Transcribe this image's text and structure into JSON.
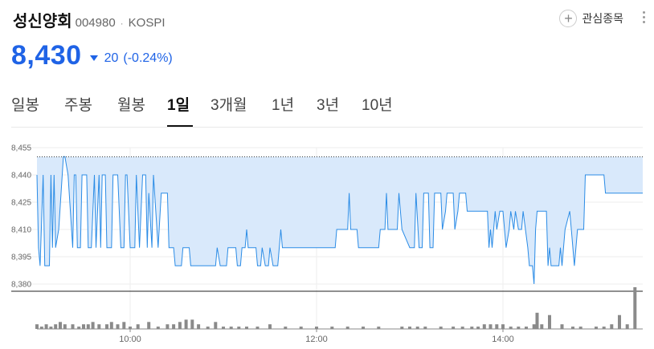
{
  "stock": {
    "name": "성신양회",
    "code": "004980",
    "market": "KOSPI",
    "price": "8,430",
    "change": "20",
    "change_pct": "(-0.24%)",
    "direction": "down",
    "accent_color": "#1f63e6"
  },
  "watchlist": {
    "label": "관심종목",
    "icon": "plus-circle-icon"
  },
  "more_menu": {
    "icon": "kebab-menu-icon"
  },
  "tabs": [
    {
      "label": "일봉",
      "active": false
    },
    {
      "label": "주봉",
      "active": false
    },
    {
      "label": "월봉",
      "active": false
    },
    {
      "label": "1일",
      "active": true
    },
    {
      "label": "3개월",
      "active": false
    },
    {
      "label": "1년",
      "active": false
    },
    {
      "label": "3년",
      "active": false
    },
    {
      "label": "10년",
      "active": false
    }
  ],
  "chart_data": {
    "type": "area",
    "y_ticks": [
      "8,455",
      "8,440",
      "8,425",
      "8,410",
      "8,395",
      "8,380"
    ],
    "ylim": [
      8380,
      8455
    ],
    "previous_close": 8450,
    "x_ticks": [
      "10:00",
      "12:00",
      "14:00"
    ],
    "time_range": [
      "09:00",
      "15:30"
    ],
    "line_color": "#2b8ce6",
    "fill_color": "#d9e9fb",
    "volume_color": "#8a8a8a",
    "price_points": [
      [
        "09:00",
        8440
      ],
      [
        "09:01",
        8400
      ],
      [
        "09:02",
        8390
      ],
      [
        "09:04",
        8440
      ],
      [
        "09:05",
        8390
      ],
      [
        "09:08",
        8390
      ],
      [
        "09:09",
        8440
      ],
      [
        "09:10",
        8400
      ],
      [
        "09:11",
        8440
      ],
      [
        "09:12",
        8400
      ],
      [
        "09:14",
        8410
      ],
      [
        "09:17",
        8450
      ],
      [
        "09:18",
        8450
      ],
      [
        "09:20",
        8440
      ],
      [
        "09:23",
        8400
      ],
      [
        "09:24",
        8440
      ],
      [
        "09:25",
        8440
      ],
      [
        "09:26",
        8400
      ],
      [
        "09:28",
        8400
      ],
      [
        "09:29",
        8440
      ],
      [
        "09:32",
        8440
      ],
      [
        "09:33",
        8400
      ],
      [
        "09:35",
        8400
      ],
      [
        "09:37",
        8440
      ],
      [
        "09:38",
        8400
      ],
      [
        "09:40",
        8440
      ],
      [
        "09:41",
        8400
      ],
      [
        "09:42",
        8440
      ],
      [
        "09:44",
        8440
      ],
      [
        "09:45",
        8400
      ],
      [
        "09:48",
        8400
      ],
      [
        "09:49",
        8440
      ],
      [
        "09:52",
        8440
      ],
      [
        "09:54",
        8400
      ],
      [
        "09:56",
        8400
      ],
      [
        "09:57",
        8440
      ],
      [
        "09:58",
        8440
      ],
      [
        "10:00",
        8400
      ],
      [
        "10:03",
        8400
      ],
      [
        "10:04",
        8440
      ],
      [
        "10:06",
        8400
      ],
      [
        "10:08",
        8440
      ],
      [
        "10:10",
        8440
      ],
      [
        "10:11",
        8400
      ],
      [
        "10:12",
        8430
      ],
      [
        "10:14",
        8400
      ],
      [
        "10:15",
        8440
      ],
      [
        "10:18",
        8400
      ],
      [
        "10:20",
        8430
      ],
      [
        "10:24",
        8430
      ],
      [
        "10:25",
        8400
      ],
      [
        "10:28",
        8400
      ],
      [
        "10:29",
        8390
      ],
      [
        "10:33",
        8390
      ],
      [
        "10:34",
        8400
      ],
      [
        "10:38",
        8400
      ],
      [
        "10:39",
        8390
      ],
      [
        "10:55",
        8390
      ],
      [
        "10:56",
        8400
      ],
      [
        "10:58",
        8390
      ],
      [
        "11:02",
        8390
      ],
      [
        "11:03",
        8400
      ],
      [
        "11:08",
        8400
      ],
      [
        "11:09",
        8390
      ],
      [
        "11:11",
        8390
      ],
      [
        "11:12",
        8400
      ],
      [
        "11:14",
        8400
      ],
      [
        "11:15",
        8410
      ],
      [
        "11:16",
        8400
      ],
      [
        "11:21",
        8400
      ],
      [
        "11:22",
        8390
      ],
      [
        "11:24",
        8390
      ],
      [
        "11:25",
        8400
      ],
      [
        "11:27",
        8390
      ],
      [
        "11:29",
        8390
      ],
      [
        "11:30",
        8400
      ],
      [
        "11:32",
        8390
      ],
      [
        "11:35",
        8390
      ],
      [
        "11:36",
        8400
      ],
      [
        "11:37",
        8410
      ],
      [
        "11:38",
        8400
      ],
      [
        "11:50",
        8400
      ],
      [
        "12:00",
        8400
      ],
      [
        "12:12",
        8400
      ],
      [
        "12:13",
        8410
      ],
      [
        "12:20",
        8410
      ],
      [
        "12:21",
        8430
      ],
      [
        "12:22",
        8410
      ],
      [
        "12:26",
        8410
      ],
      [
        "12:27",
        8400
      ],
      [
        "12:40",
        8400
      ],
      [
        "12:41",
        8410
      ],
      [
        "12:44",
        8410
      ],
      [
        "12:45",
        8430
      ],
      [
        "12:46",
        8410
      ],
      [
        "12:52",
        8410
      ],
      [
        "12:53",
        8430
      ],
      [
        "12:55",
        8410
      ],
      [
        "13:00",
        8400
      ],
      [
        "13:03",
        8400
      ],
      [
        "13:04",
        8430
      ],
      [
        "13:06",
        8400
      ],
      [
        "13:08",
        8400
      ],
      [
        "13:09",
        8430
      ],
      [
        "13:12",
        8430
      ],
      [
        "13:13",
        8400
      ],
      [
        "13:15",
        8400
      ],
      [
        "13:16",
        8430
      ],
      [
        "13:20",
        8430
      ],
      [
        "13:21",
        8410
      ],
      [
        "13:23",
        8420
      ],
      [
        "13:24",
        8430
      ],
      [
        "13:28",
        8430
      ],
      [
        "13:29",
        8410
      ],
      [
        "13:31",
        8420
      ],
      [
        "13:32",
        8430
      ],
      [
        "13:36",
        8430
      ],
      [
        "13:37",
        8420
      ],
      [
        "13:50",
        8420
      ],
      [
        "13:51",
        8400
      ],
      [
        "13:52",
        8410
      ],
      [
        "13:53",
        8400
      ],
      [
        "13:55",
        8420
      ],
      [
        "13:56",
        8410
      ],
      [
        "13:58",
        8420
      ],
      [
        "14:00",
        8420
      ],
      [
        "14:02",
        8400
      ],
      [
        "14:04",
        8410
      ],
      [
        "14:05",
        8420
      ],
      [
        "14:07",
        8410
      ],
      [
        "14:08",
        8420
      ],
      [
        "14:10",
        8410
      ],
      [
        "14:12",
        8410
      ],
      [
        "14:13",
        8420
      ],
      [
        "14:16",
        8400
      ],
      [
        "14:17",
        8390
      ],
      [
        "14:19",
        8390
      ],
      [
        "14:20",
        8380
      ],
      [
        "14:21",
        8410
      ],
      [
        "14:22",
        8420
      ],
      [
        "14:28",
        8420
      ],
      [
        "14:29",
        8390
      ],
      [
        "14:30",
        8400
      ],
      [
        "14:31",
        8390
      ],
      [
        "14:36",
        8390
      ],
      [
        "14:37",
        8400
      ],
      [
        "14:38",
        8390
      ],
      [
        "14:40",
        8410
      ],
      [
        "14:43",
        8420
      ],
      [
        "14:44",
        8410
      ],
      [
        "14:45",
        8400
      ],
      [
        "14:46",
        8390
      ],
      [
        "14:48",
        8410
      ],
      [
        "14:52",
        8410
      ],
      [
        "14:53",
        8440
      ],
      [
        "15:05",
        8440
      ],
      [
        "15:06",
        8430
      ],
      [
        "15:30",
        8430
      ]
    ],
    "volume_points": [
      [
        "09:00",
        2
      ],
      [
        "09:03",
        1
      ],
      [
        "09:06",
        2
      ],
      [
        "09:09",
        1
      ],
      [
        "09:12",
        2
      ],
      [
        "09:15",
        3
      ],
      [
        "09:18",
        2
      ],
      [
        "09:23",
        2
      ],
      [
        "09:27",
        1
      ],
      [
        "09:30",
        2
      ],
      [
        "09:33",
        2
      ],
      [
        "09:36",
        3
      ],
      [
        "09:40",
        2
      ],
      [
        "09:45",
        2
      ],
      [
        "09:48",
        3
      ],
      [
        "09:52",
        2
      ],
      [
        "09:56",
        3
      ],
      [
        "10:00",
        1
      ],
      [
        "10:05",
        2
      ],
      [
        "10:12",
        3
      ],
      [
        "10:18",
        1
      ],
      [
        "10:24",
        2
      ],
      [
        "10:28",
        2
      ],
      [
        "10:32",
        3
      ],
      [
        "10:36",
        4
      ],
      [
        "10:40",
        4
      ],
      [
        "10:44",
        2
      ],
      [
        "10:50",
        1
      ],
      [
        "10:55",
        3
      ],
      [
        "11:00",
        1
      ],
      [
        "11:05",
        1
      ],
      [
        "11:10",
        1
      ],
      [
        "11:15",
        1
      ],
      [
        "11:22",
        1
      ],
      [
        "11:30",
        2
      ],
      [
        "11:40",
        1
      ],
      [
        "11:50",
        1
      ],
      [
        "12:00",
        1
      ],
      [
        "12:10",
        1
      ],
      [
        "12:20",
        1
      ],
      [
        "12:30",
        1
      ],
      [
        "12:40",
        1
      ],
      [
        "12:55",
        1
      ],
      [
        "13:00",
        1
      ],
      [
        "13:05",
        1
      ],
      [
        "13:10",
        1
      ],
      [
        "13:20",
        1
      ],
      [
        "13:28",
        1
      ],
      [
        "13:34",
        1
      ],
      [
        "13:40",
        1
      ],
      [
        "13:44",
        1
      ],
      [
        "13:48",
        2
      ],
      [
        "13:52",
        2
      ],
      [
        "13:56",
        2
      ],
      [
        "14:00",
        2
      ],
      [
        "14:05",
        1
      ],
      [
        "14:10",
        1
      ],
      [
        "14:15",
        1
      ],
      [
        "14:20",
        2
      ],
      [
        "14:22",
        7
      ],
      [
        "14:25",
        2
      ],
      [
        "14:30",
        6
      ],
      [
        "14:38",
        2
      ],
      [
        "14:45",
        1
      ],
      [
        "14:50",
        1
      ],
      [
        "15:00",
        1
      ],
      [
        "15:05",
        1
      ],
      [
        "15:10",
        2
      ],
      [
        "15:15",
        6
      ],
      [
        "15:20",
        2
      ],
      [
        "15:25",
        18
      ]
    ]
  }
}
